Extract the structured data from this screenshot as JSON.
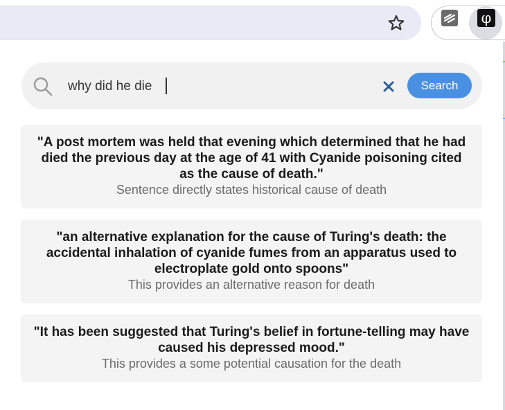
{
  "browser": {
    "star_icon": "star-outline-icon",
    "extensions": [
      "notes-extension-icon",
      "phi-extension-icon"
    ],
    "phi_glyph": "φ"
  },
  "search": {
    "query": "why did he die",
    "placeholder": "",
    "button_label": "Search",
    "clear_icon": "close-icon",
    "accent_color": "#4a90e2"
  },
  "results": [
    {
      "quote": "\"A post mortem was held that evening which determined that he had died the previous day at the age of 41 with Cyanide poisoning cited as the cause of death.\"",
      "reason": "Sentence directly states historical cause of death"
    },
    {
      "quote": "\"an alternative explanation for the cause of Turing's death: the accidental inhalation of cyanide fumes from an apparatus used to electroplate gold onto spoons\"",
      "reason": "This provides an alternative reason for death"
    },
    {
      "quote": "\"It has been suggested that Turing's belief in fortune-telling may have caused his depressed mood.\"",
      "reason": "This provides a some potential causation for the death"
    }
  ]
}
